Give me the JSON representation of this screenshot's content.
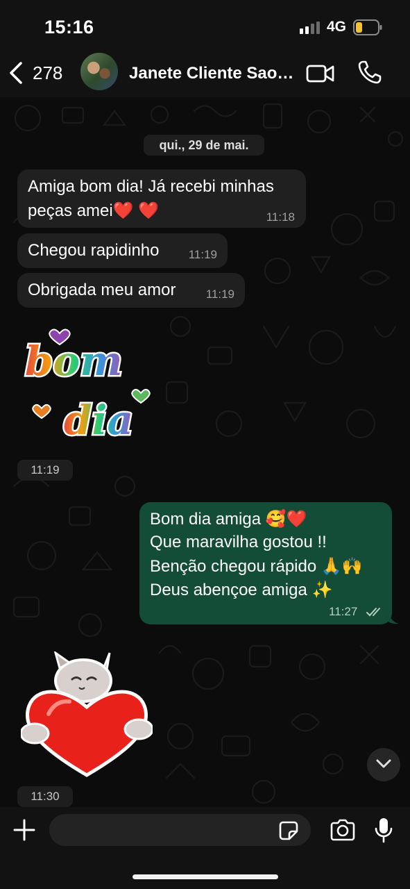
{
  "status_bar": {
    "time": "15:16",
    "network": "4G",
    "battery_color": "#f4c430"
  },
  "header": {
    "back_count": "278",
    "contact_name": "Janete Cliente Sao Paulo",
    "icons": [
      "back-chevron-icon",
      "video-call-icon",
      "phone-call-icon"
    ]
  },
  "chat": {
    "date_separator": "qui., 29 de mai.",
    "incoming": [
      {
        "lines": [
          "Amiga bom dia! Já recebi minhas",
          "peças amei❤️ ❤️"
        ],
        "time": "11:18"
      },
      {
        "lines": [
          "Chegou rapidinho"
        ],
        "time": "11:19"
      },
      {
        "lines": [
          "Obrigada meu amor"
        ],
        "time": "11:19"
      }
    ],
    "sticker_1": {
      "description_text": [
        "bom",
        "dia"
      ],
      "time": "11:19"
    },
    "outgoing": {
      "lines": [
        "Bom dia amiga 🥰❤️",
        "Que maravilha gostou !!",
        "Benção chegou rápido 🙏🙌",
        "Deus abençoe amiga ✨"
      ],
      "time": "11:27",
      "status": "read",
      "bubble_color": "#144d37"
    },
    "sticker_2": {
      "time": "11:30"
    }
  },
  "composer": {
    "input_value": "",
    "icons": [
      "plus-icon",
      "sticker-icon",
      "camera-icon",
      "microphone-icon"
    ]
  },
  "colors": {
    "incoming_bubble": "#202020",
    "outgoing_bubble": "#144d37",
    "background": "#0c0c0c"
  }
}
